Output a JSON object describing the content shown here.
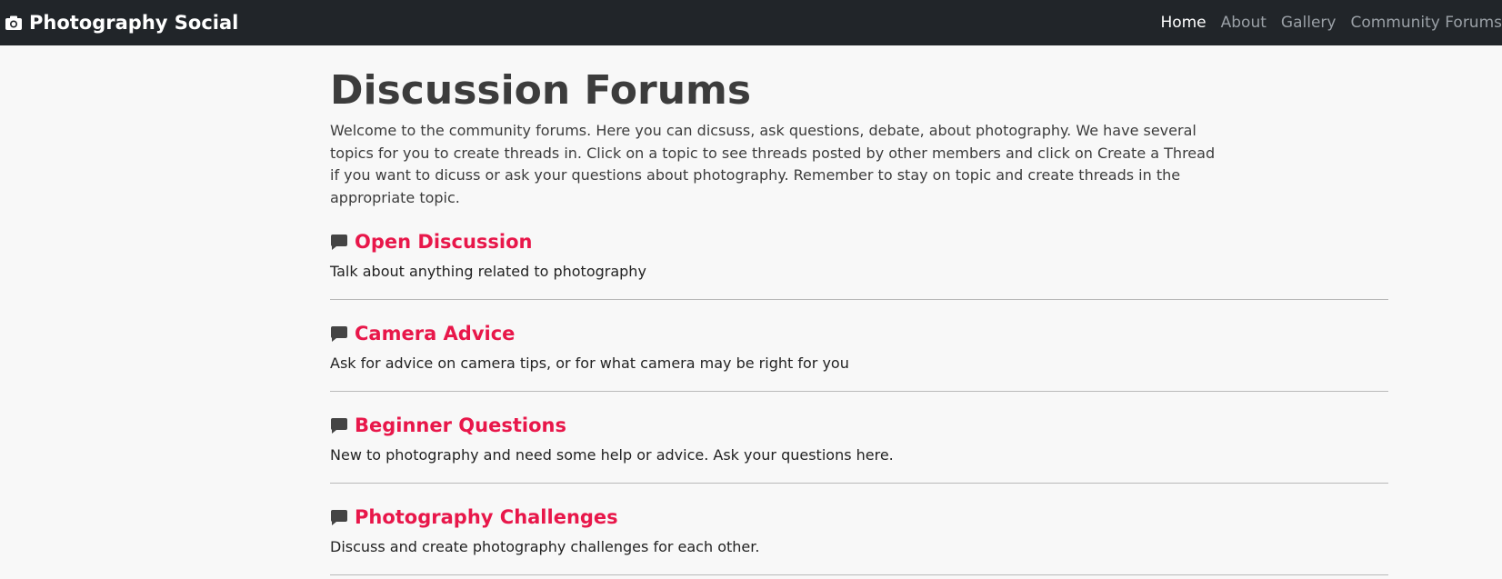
{
  "navbar": {
    "brand": "Photography Social",
    "brand_icon": "camera-icon",
    "links": [
      {
        "label": "Home",
        "active": true
      },
      {
        "label": "About",
        "active": false
      },
      {
        "label": "Gallery",
        "active": false
      },
      {
        "label": "Community Forums",
        "active": false
      }
    ]
  },
  "main": {
    "title": "Discussion Forums",
    "intro": "Welcome to the community forums. Here you can dicsuss, ask questions, debate, about photography. We have several topics for you to create threads in. Click on a topic to see threads posted by other members and click on Create a Thread if you want to dicuss or ask your questions about photography. Remember to stay on topic and create threads in the appropriate topic.",
    "topics": [
      {
        "title": "Open Discussion",
        "description": "Talk about anything related to photography",
        "icon": "comment-icon"
      },
      {
        "title": "Camera Advice",
        "description": "Ask for advice on camera tips, or for what camera may be right for you",
        "icon": "comment-icon"
      },
      {
        "title": "Beginner Questions",
        "description": "New to photography and need some help or advice. Ask your questions here.",
        "icon": "comment-icon"
      },
      {
        "title": "Photography Challenges",
        "description": "Discuss and create photography challenges for each other.",
        "icon": "comment-icon"
      }
    ]
  },
  "colors": {
    "navbar_bg": "#212529",
    "accent": "#e8174a",
    "page_bg": "#f8f8f8"
  }
}
